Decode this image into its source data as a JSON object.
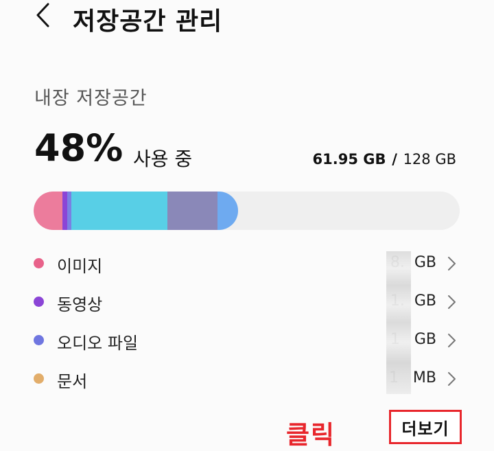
{
  "header": {
    "title": "저장공간 관리"
  },
  "internal_storage": {
    "section_title": "내장 저장공간",
    "usage_percent": "48%",
    "usage_label": "사용 중",
    "used_amount": "61.95 GB",
    "separator": "/",
    "total_amount": "128 GB",
    "bar": {
      "track_color": "#efefef",
      "segments": [
        {
          "name": "이미지",
          "color": "#ec7c9c",
          "fraction": 0.068
        },
        {
          "name": "동영상",
          "color": "#8b45d6",
          "fraction": 0.0105
        },
        {
          "name": "오디오 파일",
          "color": "#7a80e3",
          "fraction": 0.01
        },
        {
          "name": "segment-cyan",
          "color": "#58cfe6",
          "fraction": 0.226
        },
        {
          "name": "segment-slate",
          "color": "#8a88b8",
          "fraction": 0.117
        },
        {
          "name": "segment-blue",
          "color": "#6eaaf0",
          "fraction": 0.0485
        }
      ]
    }
  },
  "categories": [
    {
      "label": "이미지",
      "size": "8.  GB",
      "dot_color": "#e8628a"
    },
    {
      "label": "동영상",
      "size": "1.  GB",
      "dot_color": "#8b45d6"
    },
    {
      "label": "오디오 파일",
      "size": "1   GB",
      "dot_color": "#6f76e0"
    },
    {
      "label": "문서",
      "size": "1   MB",
      "dot_color": "#e2ad6a"
    }
  ],
  "annotation": {
    "click_label": "클릭"
  },
  "more_button": {
    "label": "더보기"
  },
  "icons": {
    "back": "chevron-left-icon",
    "row_chevron": "chevron-right-icon"
  },
  "colors": {
    "annotation_red": "#e8262c"
  }
}
